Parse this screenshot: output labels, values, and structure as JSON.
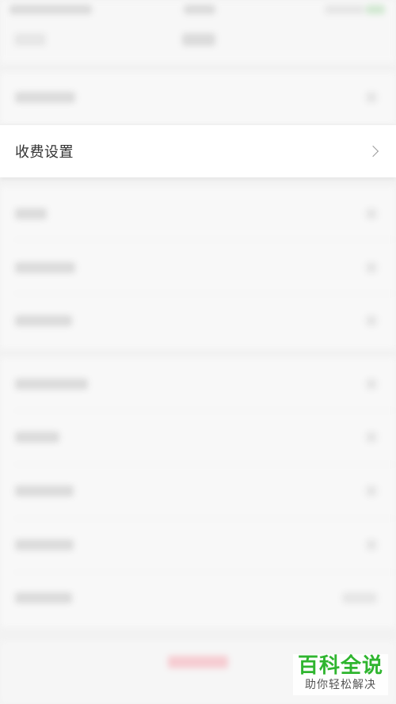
{
  "settings_list": {
    "focused_item": {
      "label": "收费设置",
      "chevron": "chevron-right-icon"
    }
  },
  "watermark": {
    "title": "百科全说",
    "subtitle": "助你轻松解决"
  },
  "colors": {
    "watermark_green": "#2fb52f",
    "background": "#f2f2f2",
    "row_background": "#ffffff",
    "text": "#333333"
  }
}
